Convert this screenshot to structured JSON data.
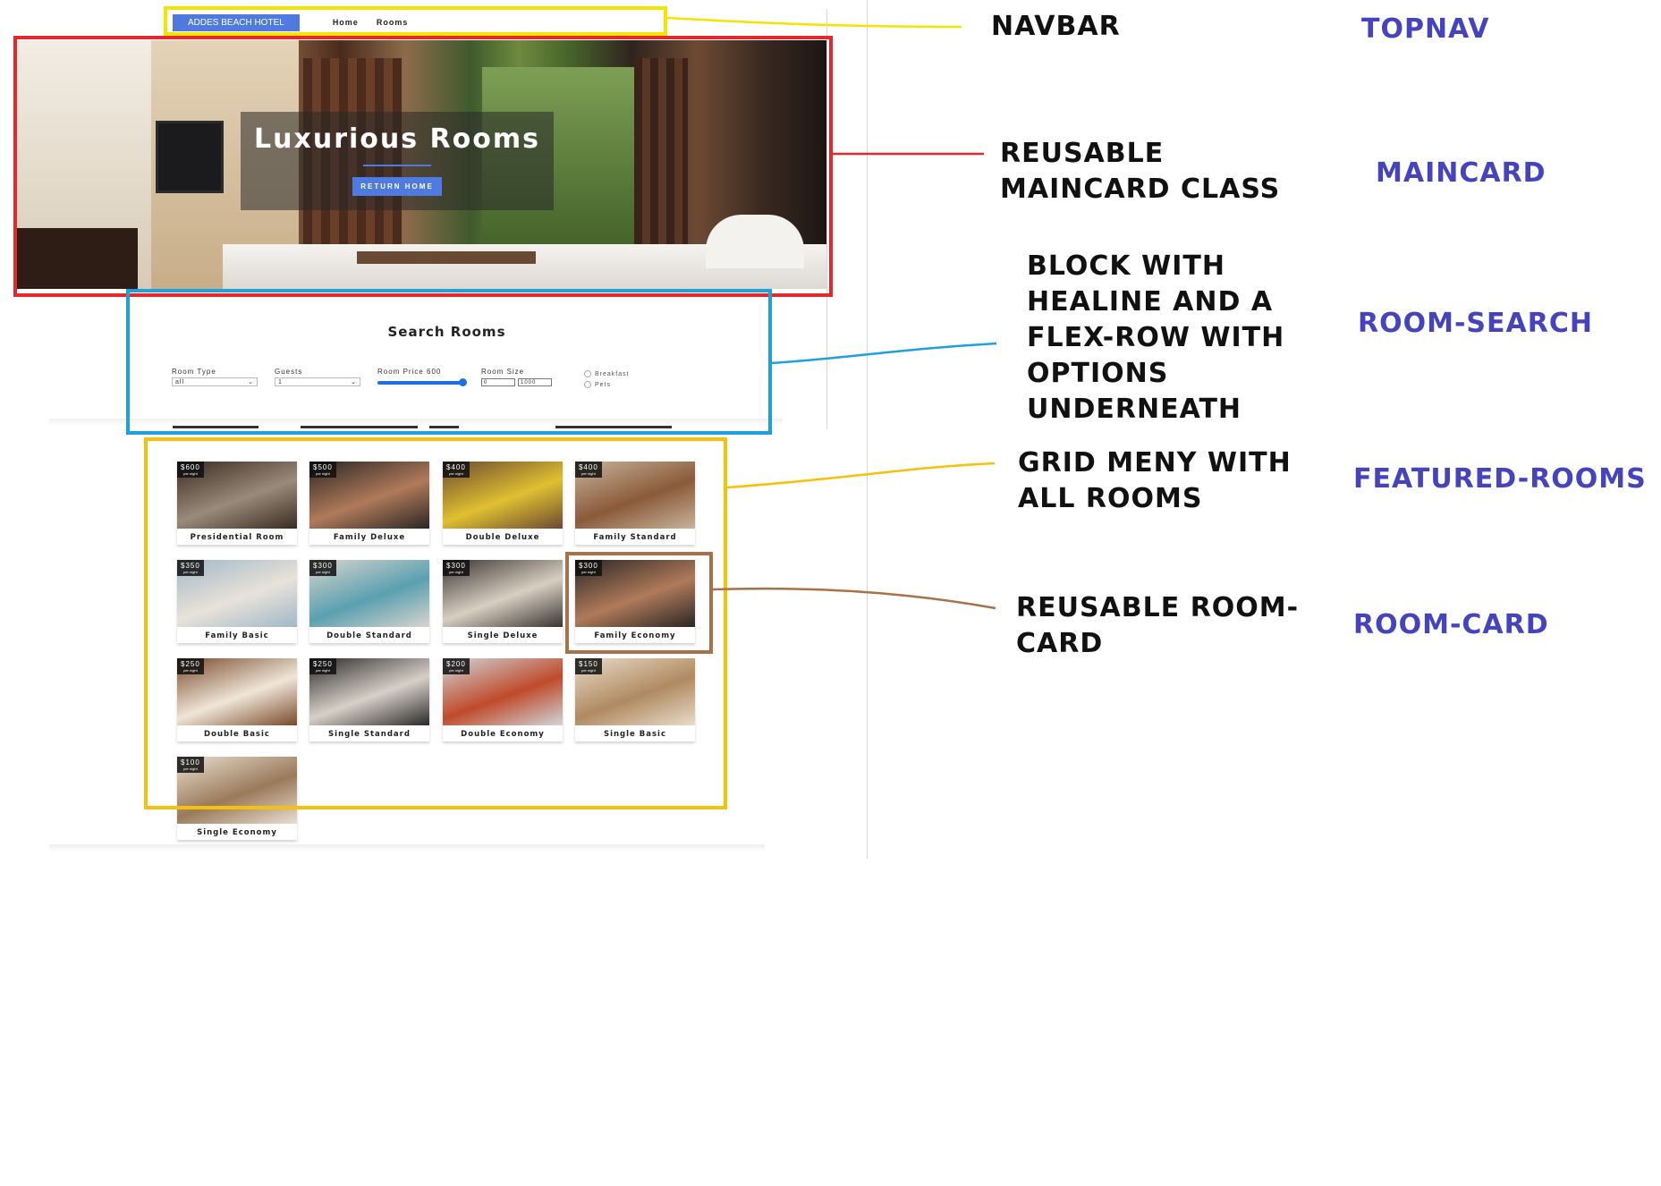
{
  "navbar": {
    "brand": "ADDES BEACH HOTEL",
    "links": [
      "Home",
      "Rooms"
    ]
  },
  "hero": {
    "title": "Luxurious Rooms",
    "button": "RETURN HOME"
  },
  "search": {
    "title": "Search Rooms",
    "room_type": {
      "label": "Room Type",
      "value": "all"
    },
    "guests": {
      "label": "Guests",
      "value": "1"
    },
    "price": {
      "label": "Room Price 600",
      "fill_fraction": 1.0
    },
    "size": {
      "label": "Room Size",
      "min": "0",
      "max": "1000"
    },
    "checks": [
      "Breakfast",
      "Pets"
    ]
  },
  "rooms": [
    {
      "name": "Presidential Room",
      "price": "$600",
      "per": "per night",
      "tone": [
        "#3a2b22",
        "#9a8a7a"
      ]
    },
    {
      "name": "Family Deluxe",
      "price": "$500",
      "per": "per night",
      "tone": [
        "#2a2624",
        "#b07a5a"
      ]
    },
    {
      "name": "Double Deluxe",
      "price": "$400",
      "per": "per night",
      "tone": [
        "#6a4a30",
        "#e0c030"
      ]
    },
    {
      "name": "Family Standard",
      "price": "$400",
      "per": "per night",
      "tone": [
        "#c8b49a",
        "#8a5a3a"
      ]
    },
    {
      "name": "Family Basic",
      "price": "$350",
      "per": "per night",
      "tone": [
        "#9fb8c8",
        "#e8e2d8"
      ]
    },
    {
      "name": "Double Standard",
      "price": "$300",
      "per": "per night",
      "tone": [
        "#d8d4ce",
        "#5aa0b0"
      ]
    },
    {
      "name": "Single Deluxe",
      "price": "$300",
      "per": "per night",
      "tone": [
        "#3a3430",
        "#d8cfc2"
      ]
    },
    {
      "name": "Family Economy",
      "price": "$300",
      "per": "per night",
      "tone": [
        "#2a2624",
        "#b07a5a"
      ]
    },
    {
      "name": "Double Basic",
      "price": "$250",
      "per": "per night",
      "tone": [
        "#7a4a2a",
        "#efe6d8"
      ]
    },
    {
      "name": "Single Standard",
      "price": "$250",
      "per": "per night",
      "tone": [
        "#2a2a2a",
        "#d8d0c8"
      ]
    },
    {
      "name": "Double Economy",
      "price": "$200",
      "per": "per night",
      "tone": [
        "#cfd6da",
        "#c04a2a"
      ]
    },
    {
      "name": "Single Basic",
      "price": "$150",
      "per": "per night",
      "tone": [
        "#e8dccb",
        "#b08a60"
      ]
    },
    {
      "name": "Single Economy",
      "price": "$100",
      "per": "per night",
      "tone": [
        "#e8ded0",
        "#9a7a5a"
      ]
    }
  ],
  "annotations": [
    {
      "text": "NAVBAR",
      "tag": "TOPNAV",
      "color": "#f5e400"
    },
    {
      "text": "REUSABLE MAINCARD CLASS",
      "lines": [
        "REUSABLE",
        "MAINCARD CLASS"
      ],
      "tag": "MAINCARD",
      "color": "#e5282b"
    },
    {
      "text": "BLOCK WITH HEALINE AND A FLEX-ROW WITH OPTIONS UNDERNEATH",
      "lines": [
        "BLOCK WITH",
        "HEALINE AND A",
        "FLEX-ROW WITH",
        "OPTIONS",
        "UNDERNEATH"
      ],
      "tag": "ROOM-SEARCH",
      "color": "#1ea0e0"
    },
    {
      "text": "GRID MENY WITH ALL ROOMS",
      "lines": [
        "GRID MENY WITH",
        "ALL ROOMS"
      ],
      "tag": "FEATURED-ROOMS",
      "color": "#f5c10a"
    },
    {
      "text": "REUSABLE ROOM-CARD",
      "lines": [
        "REUSABLE ROOM-",
        "CARD"
      ],
      "tag": "ROOM-CARD",
      "color": "#a8714a"
    }
  ]
}
